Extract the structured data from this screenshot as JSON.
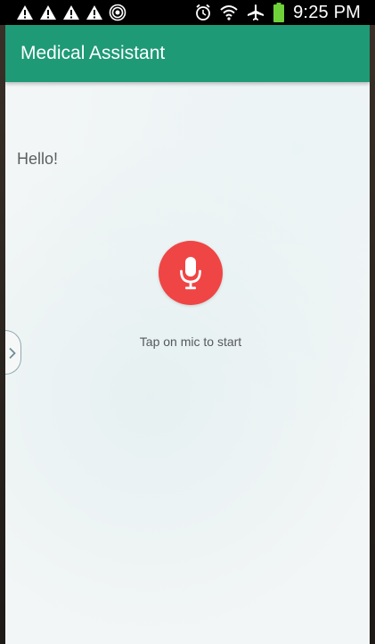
{
  "status_bar": {
    "time": "9:25 PM",
    "left_icons": [
      "warning-icon",
      "warning-icon",
      "warning-icon",
      "warning-icon",
      "nfc-icon"
    ],
    "right_icons": [
      "alarm-icon",
      "wifi-icon",
      "airplane-mode-icon",
      "battery-icon"
    ],
    "battery_color": "#6fd13a"
  },
  "app_bar": {
    "title": "Medical Assistant",
    "color": "#1e9a76"
  },
  "chat": {
    "greeting": "Hello!"
  },
  "mic": {
    "hint": "Tap on mic to start",
    "color": "#f04545",
    "icon": "microphone-icon"
  },
  "drawer_handle": {
    "icon": "chevron-right-icon"
  }
}
